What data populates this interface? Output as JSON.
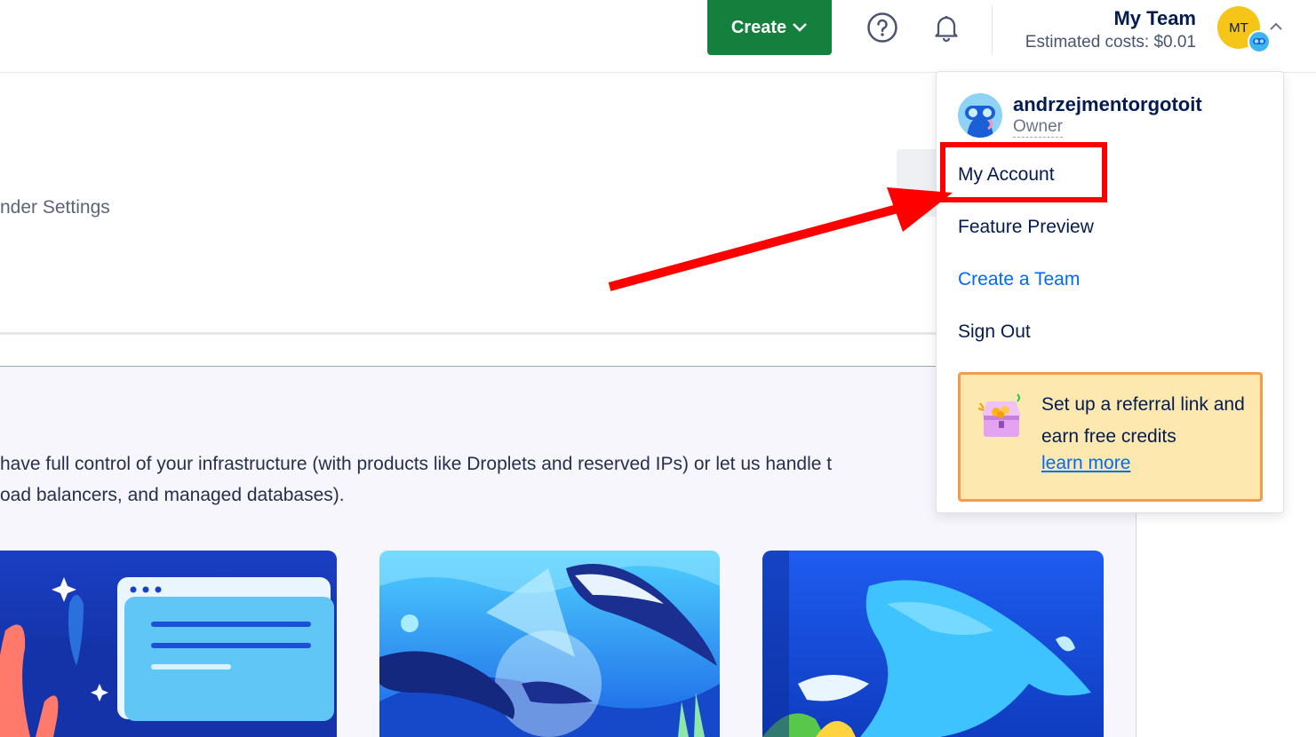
{
  "topbar": {
    "create_label": "Create",
    "team_name": "My Team",
    "estimated_costs": "Estimated costs: $0.01",
    "avatar_initials": "MT"
  },
  "main": {
    "settings_fragment": "nder Settings",
    "description_line1": "have full control of your infrastructure (with products like Droplets and reserved IPs) or let us handle t",
    "description_line2": "oad balancers, and managed databases)."
  },
  "dropdown": {
    "username": "andrzejmentorgotoit",
    "role": "Owner",
    "items": [
      {
        "label": "My Account"
      },
      {
        "label": "Feature Preview"
      },
      {
        "label": "Create a Team"
      },
      {
        "label": "Sign Out"
      }
    ],
    "referral": {
      "text": "Set up a referral link and earn free credits",
      "link_label": "learn more"
    }
  },
  "colors": {
    "create_button": "#15803d",
    "link": "#0069ff",
    "highlight": "#ff0000",
    "referral_bg": "#fde9b0",
    "referral_border": "#f49b4a"
  }
}
